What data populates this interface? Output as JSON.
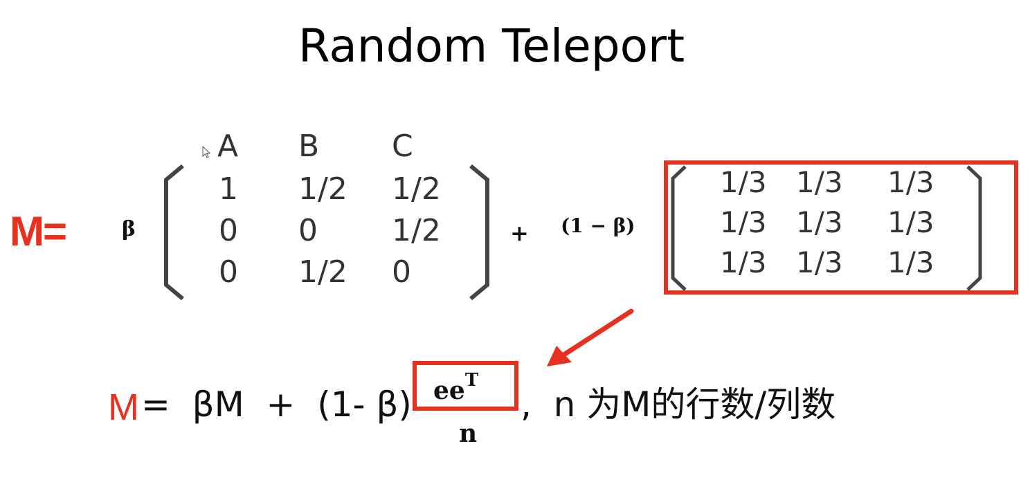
{
  "slide": {
    "title": "Random Teleport",
    "matrix_label": "M=",
    "beta": "β",
    "plus": "+",
    "one_minus_beta": "(1 − β)",
    "column_headers": [
      "A",
      "B",
      "C"
    ],
    "matrix_rows": [
      [
        "1",
        "1/2",
        "1/2"
      ],
      [
        "0",
        "0",
        "1/2"
      ],
      [
        "0",
        "1/2",
        "0"
      ]
    ],
    "uniform_rows": [
      [
        "1/3",
        "1/3",
        "1/3"
      ],
      [
        "1/3",
        "1/3",
        "1/3"
      ],
      [
        "1/3",
        "1/3",
        "1/3"
      ]
    ],
    "formula": {
      "m": "M",
      "eq_part": "=  βM  +  (1- β)",
      "numerator": "ee",
      "superscript": "T",
      "denominator": "n",
      "suffix": ",  n 为M的行数/列数"
    },
    "colors": {
      "accent": "#e8301e",
      "text": "#111111"
    }
  }
}
